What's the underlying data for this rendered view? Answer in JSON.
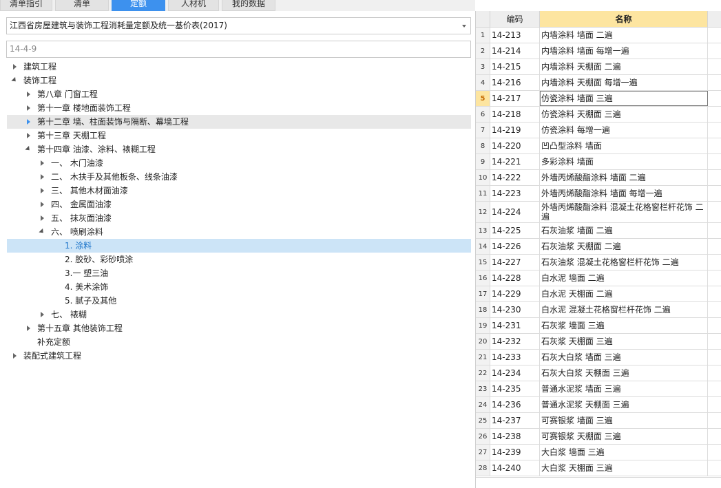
{
  "tabs": [
    {
      "label": "清单指引"
    },
    {
      "label": "清单"
    },
    {
      "label": "定额"
    },
    {
      "label": "人材机"
    },
    {
      "label": "我的数据"
    }
  ],
  "active_tab_index": 2,
  "quota_library": {
    "selected": "江西省房屋建筑与装饰工程消耗量定额及统一基价表(2017)"
  },
  "search": {
    "value": "14-4-9"
  },
  "tree": [
    {
      "label": "建筑工程"
    },
    {
      "label": "装饰工程"
    },
    {
      "label": "第八章 门窗工程"
    },
    {
      "label": "第十一章 楼地面装饰工程"
    },
    {
      "label": "第十二章 墙、柱面装饰与隔断、幕墙工程"
    },
    {
      "label": "第十三章 天棚工程"
    },
    {
      "label": "第十四章 油漆、涂料、裱糊工程"
    },
    {
      "label": "一、  木门油漆"
    },
    {
      "label": "二、  木扶手及其他板条、线条油漆"
    },
    {
      "label": "三、  其他木材面油漆"
    },
    {
      "label": "四、  金属面油漆"
    },
    {
      "label": "五、  抹灰面油漆"
    },
    {
      "label": "六、  喷刷涂料"
    },
    {
      "label": "1. 涂料"
    },
    {
      "label": "2. 胶砂、彩砂喷涂"
    },
    {
      "label": "3.一 塑三油"
    },
    {
      "label": "4. 美术涂饰"
    },
    {
      "label": "5. 腻子及其他"
    },
    {
      "label": "七、  裱糊"
    },
    {
      "label": "第十五章 其他装饰工程"
    },
    {
      "label": "补充定额"
    },
    {
      "label": "装配式建筑工程"
    }
  ],
  "grid": {
    "columns": {
      "code": "编码",
      "name": "名称"
    },
    "current_row": 5,
    "rows": [
      {
        "idx": "1",
        "code": "14-213",
        "name": "内墙涂料 墙面 二遍"
      },
      {
        "idx": "2",
        "code": "14-214",
        "name": "内墙涂料 墙面 每增一遍"
      },
      {
        "idx": "3",
        "code": "14-215",
        "name": "内墙涂料 天棚面 二遍"
      },
      {
        "idx": "4",
        "code": "14-216",
        "name": "内墙涂料 天棚面 每增一遍"
      },
      {
        "idx": "5",
        "code": "14-217",
        "name": "仿瓷涂料 墙面 三遍"
      },
      {
        "idx": "6",
        "code": "14-218",
        "name": "仿瓷涂料 天棚面 三遍"
      },
      {
        "idx": "7",
        "code": "14-219",
        "name": "仿瓷涂料 每增一遍"
      },
      {
        "idx": "8",
        "code": "14-220",
        "name": "凹凸型涂料 墙面"
      },
      {
        "idx": "9",
        "code": "14-221",
        "name": "多彩涂料 墙面"
      },
      {
        "idx": "10",
        "code": "14-222",
        "name": "外墙丙烯酸酯涂料 墙面 二遍"
      },
      {
        "idx": "11",
        "code": "14-223",
        "name": "外墙丙烯酸酯涂料 墙面 每增一遍"
      },
      {
        "idx": "12",
        "code": "14-224",
        "name": "外墙丙烯酸酯涂料 混凝土花格窗栏杆花饰 二遍"
      },
      {
        "idx": "13",
        "code": "14-225",
        "name": "石灰油浆 墙面 二遍"
      },
      {
        "idx": "14",
        "code": "14-226",
        "name": "石灰油浆 天棚面 二遍"
      },
      {
        "idx": "15",
        "code": "14-227",
        "name": "石灰油浆 混凝土花格窗栏杆花饰 二遍"
      },
      {
        "idx": "16",
        "code": "14-228",
        "name": "白水泥 墙面 二遍"
      },
      {
        "idx": "17",
        "code": "14-229",
        "name": "白水泥 天棚面 二遍"
      },
      {
        "idx": "18",
        "code": "14-230",
        "name": "白水泥 混凝土花格窗栏杆花饰 二遍"
      },
      {
        "idx": "19",
        "code": "14-231",
        "name": "石灰浆 墙面 三遍"
      },
      {
        "idx": "20",
        "code": "14-232",
        "name": "石灰浆 天棚面 三遍"
      },
      {
        "idx": "21",
        "code": "14-233",
        "name": "石灰大白浆 墙面 三遍"
      },
      {
        "idx": "22",
        "code": "14-234",
        "name": "石灰大白浆 天棚面 三遍"
      },
      {
        "idx": "23",
        "code": "14-235",
        "name": "普通水泥浆 墙面 三遍"
      },
      {
        "idx": "24",
        "code": "14-236",
        "name": "普通水泥浆 天棚面 三遍"
      },
      {
        "idx": "25",
        "code": "14-237",
        "name": "可赛银浆 墙面 三遍"
      },
      {
        "idx": "26",
        "code": "14-238",
        "name": "可赛银浆 天棚面 三遍"
      },
      {
        "idx": "27",
        "code": "14-239",
        "name": "大白浆 墙面 三遍"
      },
      {
        "idx": "28",
        "code": "14-240",
        "name": "大白浆 天棚面 三遍"
      }
    ]
  },
  "colors": {
    "accent": "#3d91ee",
    "selection": "#cce4f7",
    "header_highlight": "#fde5a0"
  }
}
